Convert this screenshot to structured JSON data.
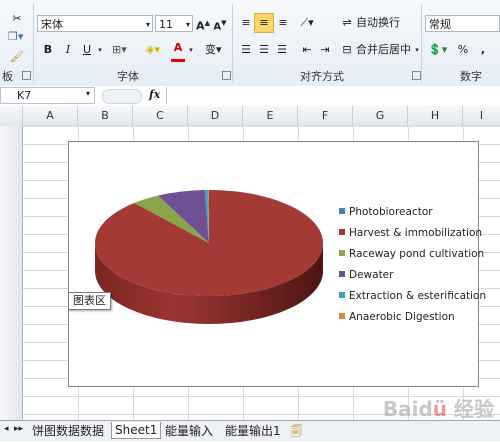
{
  "ribbon": {
    "clipboard_label": "板",
    "cut_icon": "scissors-icon",
    "copy_icon": "copy-icon",
    "format_painter_icon": "format-painter-icon",
    "font_name": "宋体",
    "font_size": "11",
    "bold": "B",
    "italic": "I",
    "underline": "U",
    "font_group_label": "字体",
    "wrap_text_label": "自动换行",
    "merge_center_label": "合并后居中",
    "align_group_label": "对齐方式",
    "number_format": "常规",
    "percent": "%",
    "comma": ",",
    "number_group_label": "数字"
  },
  "formula_bar": {
    "name_box": "K7",
    "fx": "fx"
  },
  "columns": [
    "A",
    "B",
    "C",
    "D",
    "E",
    "F",
    "G",
    "H",
    "I"
  ],
  "chart_data": {
    "type": "pie",
    "three_d": true,
    "categories": [
      "Photobioreactor",
      "Harvest & immobilization",
      "Raceway pond cultivation",
      "Dewater",
      "Extraction & esterification",
      "Anaerobic Digestion"
    ],
    "values": [
      0.1,
      88.6,
      4.0,
      6.8,
      0.4,
      0.1
    ],
    "colors": [
      "#4a7ebb",
      "#a33a36",
      "#8aa64a",
      "#6f5295",
      "#3ca5c2",
      "#e08a3c"
    ],
    "legend_position": "right"
  },
  "chart_tooltip": "图表区",
  "sheet_tabs": [
    "饼图数据数据",
    "Sheet1",
    "能量输入",
    "能量输出1"
  ],
  "active_tab": "Sheet1",
  "watermark": "Baidu 经验"
}
